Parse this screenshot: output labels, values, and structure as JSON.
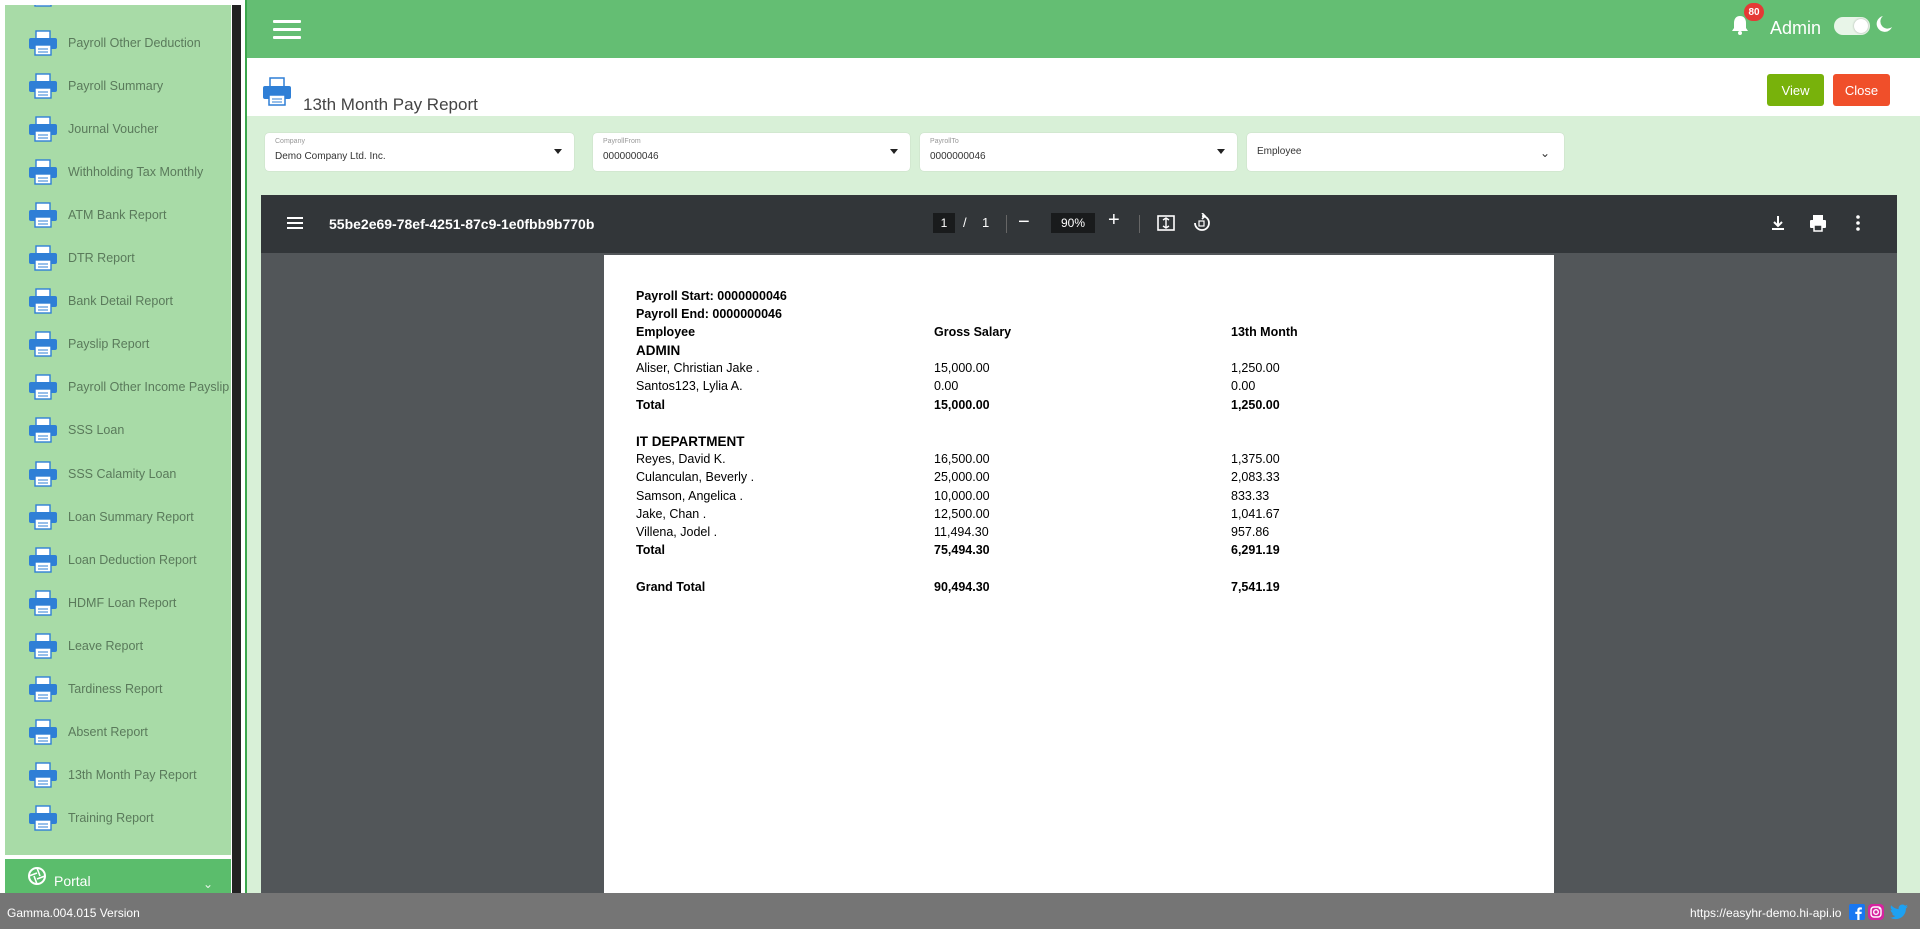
{
  "sidebar": {
    "items": [
      {
        "label": "Payroll Other Deduction"
      },
      {
        "label": "Payroll Summary"
      },
      {
        "label": "Journal Voucher"
      },
      {
        "label": "Withholding Tax Monthly"
      },
      {
        "label": "ATM Bank Report"
      },
      {
        "label": "DTR Report"
      },
      {
        "label": "Bank Detail Report"
      },
      {
        "label": "Payslip Report"
      },
      {
        "label": "Payroll Other Income Payslip"
      },
      {
        "label": "SSS Loan"
      },
      {
        "label": "SSS Calamity Loan"
      },
      {
        "label": "Loan Summary Report"
      },
      {
        "label": "Loan Deduction Report"
      },
      {
        "label": "HDMF Loan Report"
      },
      {
        "label": "Leave Report"
      },
      {
        "label": "Tardiness Report"
      },
      {
        "label": "Absent Report"
      },
      {
        "label": "13th Month Pay Report"
      },
      {
        "label": "Training Report"
      }
    ],
    "portal_label": "Portal",
    "icon": "printer-icon"
  },
  "topbar": {
    "notification_count": "80",
    "user_name": "Admin"
  },
  "page": {
    "title": "13th Month Pay Report",
    "view_label": "View",
    "close_label": "Close"
  },
  "filters": {
    "company": {
      "label": "Company",
      "value": "Demo Company Ltd. Inc."
    },
    "payroll_from": {
      "label": "PayrollFrom",
      "value": "0000000046"
    },
    "payroll_to": {
      "label": "PayrollTo",
      "value": "0000000046"
    },
    "employee": {
      "placeholder": "Employee"
    }
  },
  "pdf_viewer": {
    "file_name": "55be2e69-78ef-4251-87c9-1e0fbb9b770b",
    "current_page": "1",
    "separator": "/",
    "total_pages": "1",
    "zoom": "90%"
  },
  "report": {
    "payroll_start": "Payroll Start: 0000000046",
    "payroll_end": "Payroll End: 0000000046",
    "headers": {
      "employee": "Employee",
      "gross": "Gross Salary",
      "thirteenth": "13th Month"
    },
    "departments": [
      {
        "name": "ADMIN",
        "rows": [
          {
            "employee": "Aliser, Christian Jake .",
            "gross": "15,000.00",
            "thirteenth": "1,250.00"
          },
          {
            "employee": "Santos123, Lylia A.",
            "gross": "0.00",
            "thirteenth": "0.00"
          }
        ],
        "total_label": "Total",
        "total_gross": "15,000.00",
        "total_thirteenth": "1,250.00"
      },
      {
        "name": "IT DEPARTMENT",
        "rows": [
          {
            "employee": "Reyes, David K.",
            "gross": "16,500.00",
            "thirteenth": "1,375.00"
          },
          {
            "employee": "Culanculan, Beverly .",
            "gross": "25,000.00",
            "thirteenth": "2,083.33"
          },
          {
            "employee": "Samson, Angelica .",
            "gross": "10,000.00",
            "thirteenth": "833.33"
          },
          {
            "employee": "Jake, Chan .",
            "gross": "12,500.00",
            "thirteenth": "1,041.67"
          },
          {
            "employee": "Villena, Jodel .",
            "gross": "11,494.30",
            "thirteenth": "957.86"
          }
        ],
        "total_label": "Total",
        "total_gross": "75,494.30",
        "total_thirteenth": "6,291.19"
      }
    ],
    "grand_total_label": "Grand Total",
    "grand_total_gross": "90,494.30",
    "grand_total_thirteenth": "7,541.19"
  },
  "footer": {
    "version": "Gamma.004.015 Version",
    "url": "https://easyhr-demo.hi-api.io"
  },
  "colors": {
    "topbar": "#64be73",
    "sidebar": "#a8dba7",
    "view_button": "#78b20b",
    "close_button": "#f04f2a",
    "printer_icon": "#2f7fd6"
  }
}
